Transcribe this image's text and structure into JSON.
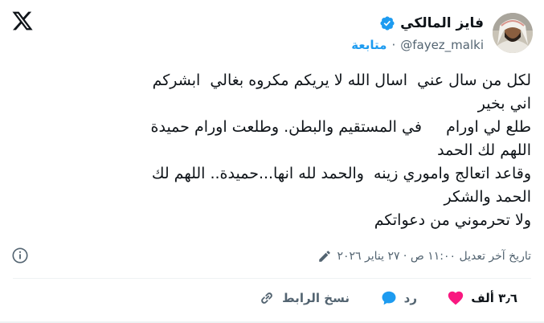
{
  "post": {
    "author": {
      "display_name": "فايز المالكي",
      "handle": "@fayez_malki",
      "verified": true,
      "verified_color": "#1d9bf0"
    },
    "follow_label": "متابعة",
    "separator": "·",
    "text_lines": [
      "لكل من سال عني  اسال الله لا يريكم مكروه بغالي  ابشركم",
      "اني بخير",
      "طلع لي اورام     في المستقيم والبطن. وطلعت اورام حميدة",
      "اللهم لك الحمد",
      "وقاعد اتعالج واموري زينه  والحمد لله انها...حميدة.. اللهم لك",
      "الحمد والشكر",
      "ولا تحرموني من دعواتكم"
    ],
    "edited_label": "تاريخ آخر تعديل ١١:٠٠ ص · ٢٧ يناير ٢٠٢٦",
    "actions": {
      "like_count": "٣٫٦ ألف",
      "reply_label": "رد",
      "copy_link_label": "نسخ الرابط"
    },
    "colors": {
      "like": "#f91880",
      "reply": "#1d9bf0",
      "link": "#1d9bf0",
      "muted": "#536471"
    },
    "icons": {
      "brand": "x-logo-icon",
      "verified": "verified-badge-icon",
      "edit": "pencil-icon",
      "info": "info-icon",
      "like": "heart-icon",
      "reply": "speech-bubble-icon",
      "copy": "link-icon"
    }
  }
}
